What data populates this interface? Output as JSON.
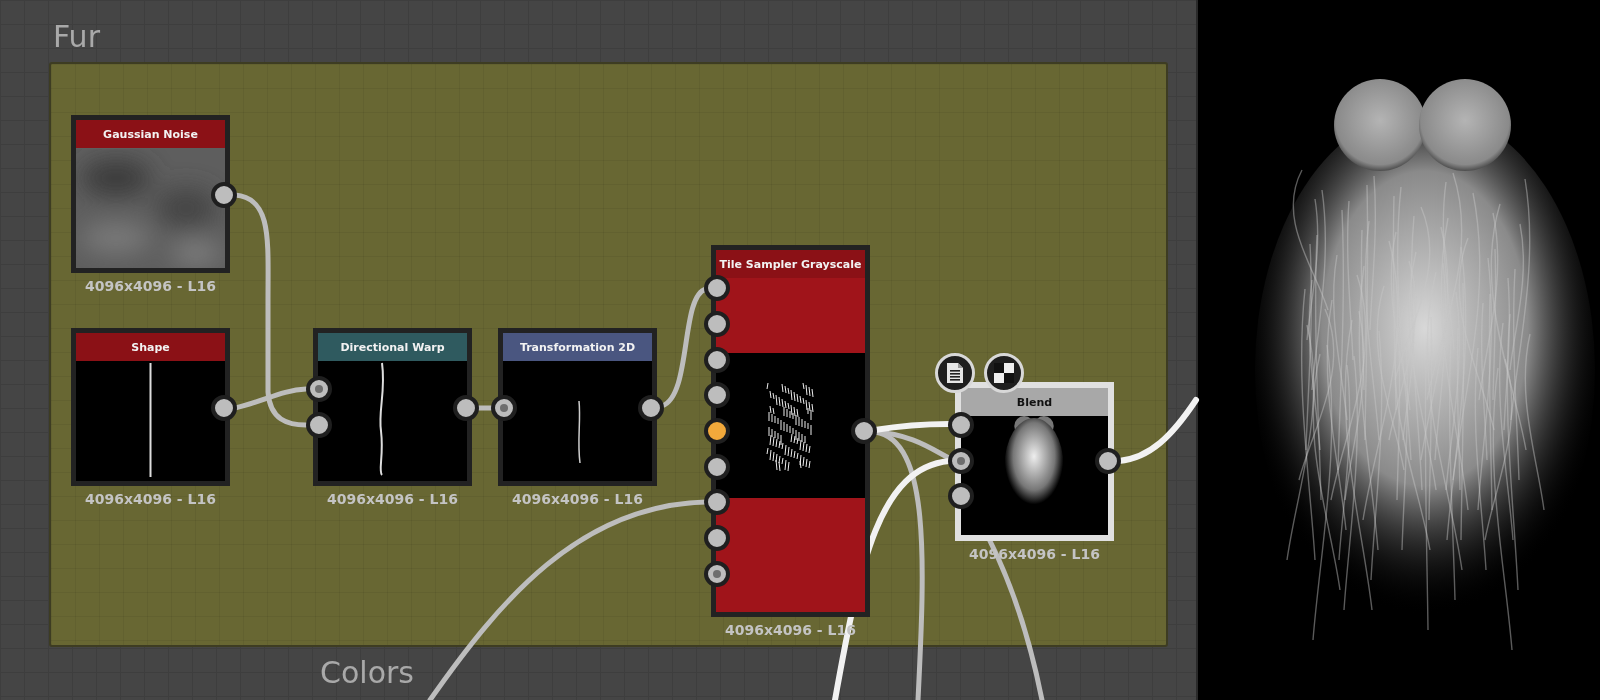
{
  "frames": [
    {
      "title": "Fur"
    },
    {
      "title": "Colors"
    }
  ],
  "nodes": [
    {
      "title": "Gaussian Noise",
      "kind": "noise",
      "color": "#8b1116",
      "selected": false,
      "resolution": "4096x4096 - L16",
      "outputs": [
        {
          "kind": "plain",
          "highlighted": false
        }
      ]
    },
    {
      "title": "Shape",
      "kind": "line",
      "color": "#8b1116",
      "selected": false,
      "resolution": "4096x4096 - L16",
      "outputs": [
        {
          "kind": "plain",
          "highlighted": false
        }
      ]
    },
    {
      "title": "Directional Warp",
      "kind": "wavy-line",
      "color": "#2f5a5f",
      "selected": false,
      "resolution": "4096x4096 - L16",
      "inputs": [
        {
          "kind": "dotted",
          "highlighted": false
        },
        {
          "kind": "plain",
          "highlighted": false
        }
      ],
      "outputs": [
        {
          "kind": "plain",
          "highlighted": false
        }
      ]
    },
    {
      "title": "Transformation 2D",
      "kind": "short-line",
      "color": "#4a5680",
      "selected": false,
      "resolution": "4096x4096 - L16",
      "inputs": [
        {
          "kind": "dotted",
          "highlighted": false
        }
      ],
      "outputs": [
        {
          "kind": "plain",
          "highlighted": false
        }
      ]
    },
    {
      "title": "Tile Sampler Grayscale",
      "kind": "scatter",
      "color": "#8b1116",
      "selected": false,
      "resolution": "4096x4096 - L16",
      "inputs": [
        {
          "kind": "plain",
          "highlighted": false
        },
        {
          "kind": "plain",
          "highlighted": false
        },
        {
          "kind": "plain",
          "highlighted": false
        },
        {
          "kind": "plain",
          "highlighted": false
        },
        {
          "kind": "plain",
          "highlighted": true
        },
        {
          "kind": "plain",
          "highlighted": false
        },
        {
          "kind": "plain",
          "highlighted": false
        },
        {
          "kind": "plain",
          "highlighted": false
        },
        {
          "kind": "dotted",
          "highlighted": false
        }
      ],
      "outputs": [
        {
          "kind": "plain",
          "highlighted": false
        }
      ]
    },
    {
      "title": "Blend",
      "kind": "blob",
      "color": "#a8a8a8",
      "selected": true,
      "resolution": "4096x4096 - L16",
      "inputs": [
        {
          "kind": "plain",
          "highlighted": false
        },
        {
          "kind": "dotted",
          "highlighted": false
        },
        {
          "kind": "plain",
          "highlighted": false
        }
      ],
      "outputs": [
        {
          "kind": "plain",
          "highlighted": false
        }
      ]
    }
  ]
}
